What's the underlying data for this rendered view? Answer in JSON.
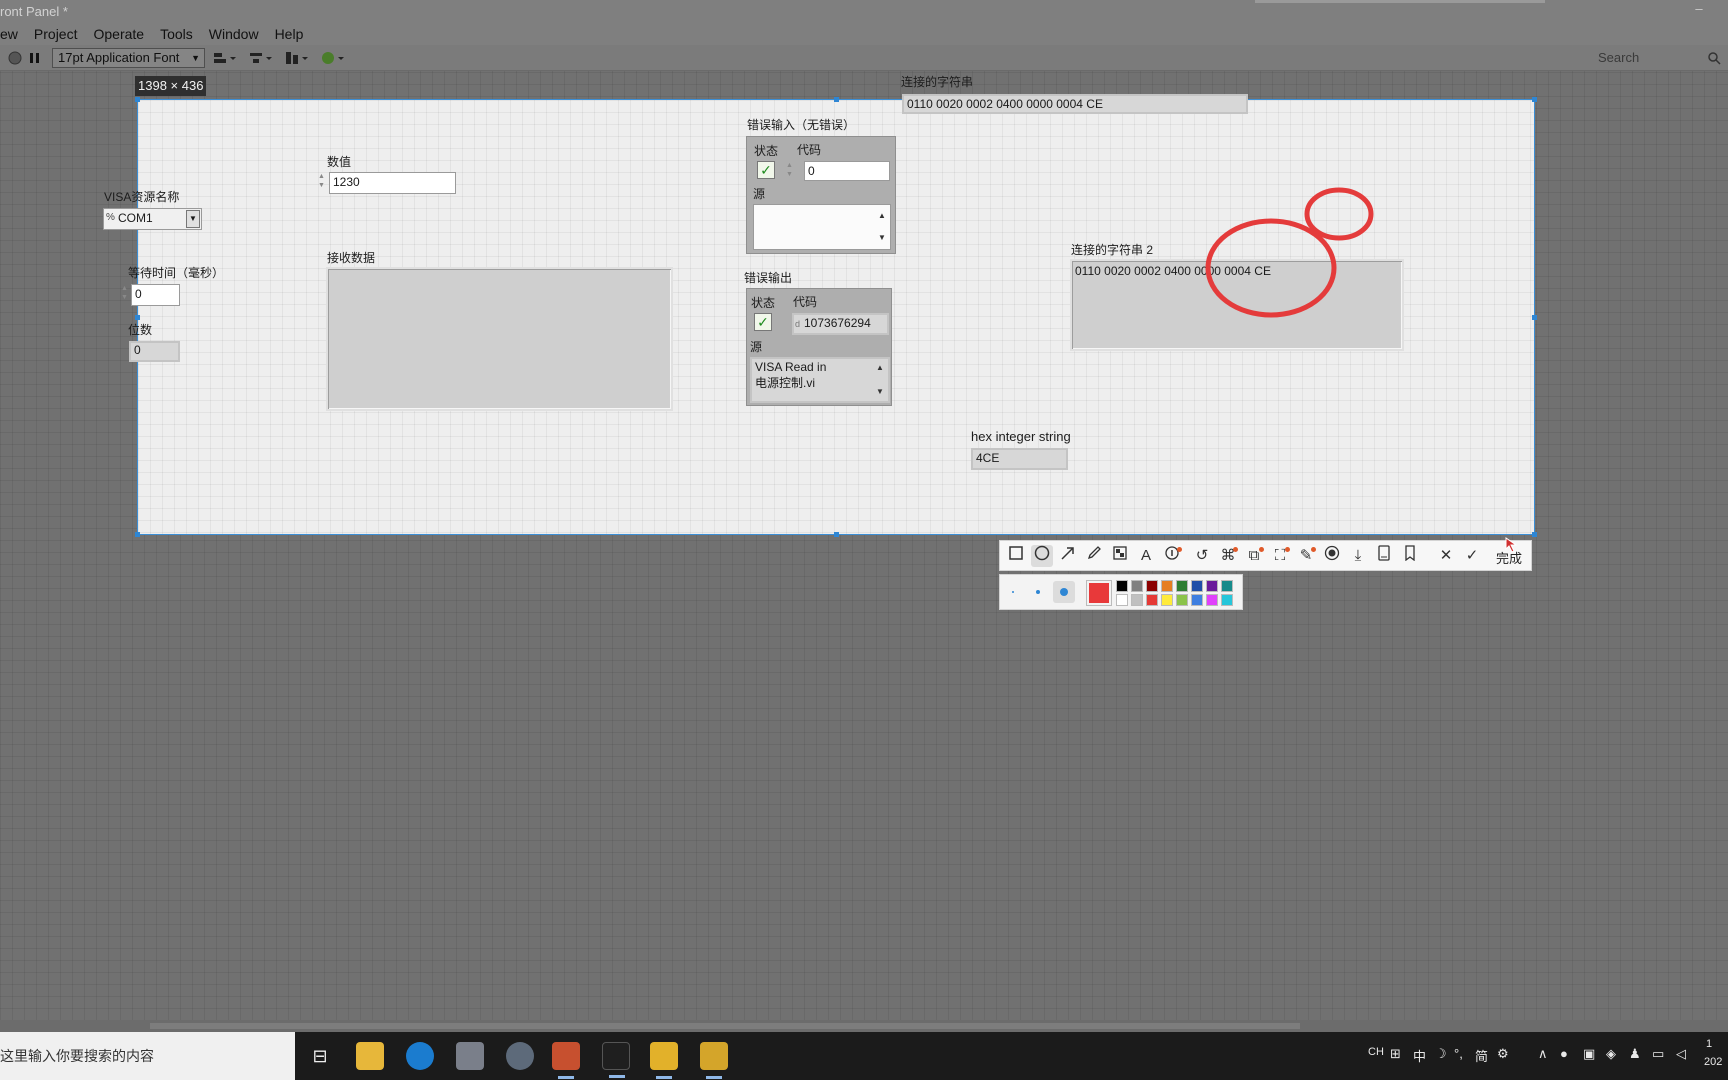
{
  "window": {
    "title": "ront Panel *"
  },
  "menu": {
    "items": [
      "ew",
      "Project",
      "Operate",
      "Tools",
      "Window",
      "Help"
    ]
  },
  "toolbar": {
    "font_select": "17pt Application Font",
    "search_placeholder": "Search"
  },
  "capture": {
    "size_label": "1398 × 436"
  },
  "panel": {
    "concat_string": {
      "label": "连接的字符串",
      "value": "0110 0020 0002 0400 0000 0004 CE"
    },
    "visa": {
      "label": "VISA资源名称",
      "prefix": "%",
      "value": "COM1"
    },
    "numeric": {
      "label": "数值",
      "value": "1230"
    },
    "timeout": {
      "label": "等待时间（毫秒）",
      "value": "0"
    },
    "bits": {
      "label": "位数",
      "value": "0"
    },
    "receive": {
      "label": "接收数据",
      "value": ""
    },
    "error_in": {
      "label": "错误输入（无错误）",
      "status_label": "状态",
      "code_label": "代码",
      "code_value": "0",
      "source_label": "源",
      "source_value": ""
    },
    "error_out": {
      "label": "错误输出",
      "status_label": "状态",
      "code_label": "代码",
      "code_prefix": "d",
      "code_value": "1073676294",
      "source_label": "源",
      "source_line1": "VISA Read in",
      "source_line2": "电源控制.vi"
    },
    "concat_string2": {
      "label": "连接的字符串 2",
      "value": "0110 0020 0002 0400 0000 0004 CE"
    },
    "hex": {
      "label": "hex integer string",
      "value": "4CE"
    }
  },
  "annotation": {
    "done_label": "完成",
    "tools": [
      "rectangle-icon",
      "ellipse-icon",
      "arrow-icon",
      "pencil-icon",
      "mosaic-icon",
      "text-icon",
      "number-marker-icon",
      "undo-icon",
      "pin-icon",
      "translate-icon",
      "ocr-icon",
      "tack-icon",
      "record-icon",
      "download-icon",
      "save-icon",
      "bookmark-icon",
      "close-icon",
      "check-icon"
    ],
    "active_color": "#e8393a",
    "palette_top": [
      "#000000",
      "#808080",
      "#8b0000",
      "#e67e22",
      "#2e7d32",
      "#1f4fa8",
      "#6a1b9a",
      "#168a8a"
    ],
    "palette_bottom": [
      "#ffffff",
      "#c0c0c0",
      "#e53935",
      "#ffeb3b",
      "#8bc34a",
      "#3f7fe0",
      "#e040fb",
      "#26c6da"
    ]
  },
  "taskbar": {
    "search_text": "在这里输入你要搜索的内容",
    "ime": [
      "CH",
      "⊞",
      "中",
      "☽",
      "°,",
      "简",
      "⚙"
    ],
    "clock_line1": "1",
    "clock_line2": "202"
  }
}
